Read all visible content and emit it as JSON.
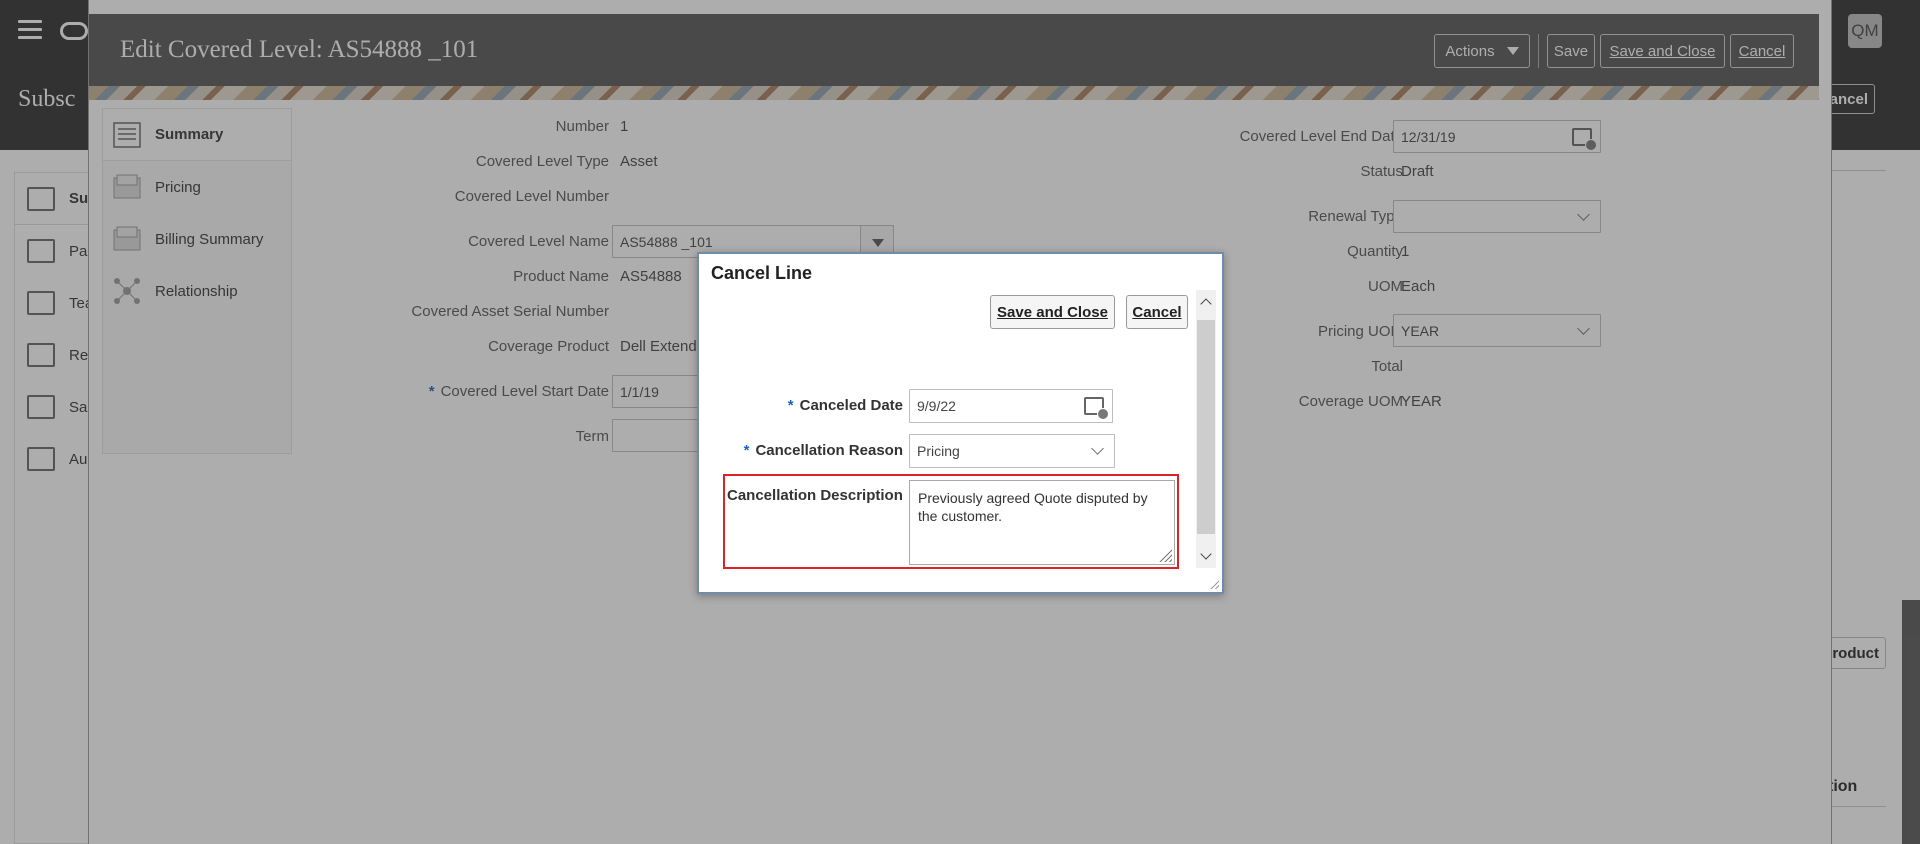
{
  "app": {
    "title_partial": "Subsc",
    "avatar_initials": "QM",
    "bg_cancel_partial": "ancel",
    "bg_product_partial": "roduct",
    "bg_section_partial": "tion",
    "left_nav": [
      {
        "label": "Sur",
        "icon": "list-icon"
      },
      {
        "label": "Par",
        "icon": "contact-card-icon"
      },
      {
        "label": "Tea",
        "icon": "team-icon"
      },
      {
        "label": "Ren",
        "icon": "sliders-icon"
      },
      {
        "label": "Sal",
        "icon": "grid-icon"
      },
      {
        "label": "Aud",
        "icon": "audit-icon"
      }
    ]
  },
  "drawer": {
    "title": "Edit Covered Level: AS54888 _101",
    "actions_label": "Actions",
    "save_label": "Save",
    "save_and_close_label": "Save and Close",
    "cancel_label": "Cancel",
    "side_nav": [
      {
        "label": "Summary",
        "icon": "summary-icon"
      },
      {
        "label": "Pricing",
        "icon": "pricing-icon"
      },
      {
        "label": "Billing Summary",
        "icon": "billing-icon"
      },
      {
        "label": "Relationship",
        "icon": "relationship-icon"
      }
    ],
    "left_fields": {
      "number_label": "Number",
      "number_value": "1",
      "type_label": "Covered Level Type",
      "type_value": "Asset",
      "cl_number_label": "Covered Level Number",
      "name_label": "Covered Level Name",
      "name_value": "AS54888 _101",
      "product_label": "Product Name",
      "product_value": "AS54888",
      "serial_label": "Covered Asset Serial Number",
      "coverage_label": "Coverage Product",
      "coverage_value": "Dell Extend",
      "start_label": "Covered Level Start Date",
      "start_value": "1/1/19",
      "term_label": "Term"
    },
    "right_fields": {
      "end_label": "Covered Level End Date",
      "end_value": "12/31/19",
      "status_label": "Status",
      "status_value": "Draft",
      "renewal_label": "Renewal Type",
      "renewal_value": "",
      "quantity_label": "Quantity",
      "quantity_value": "1",
      "uom_label": "UOM",
      "uom_value": "Each",
      "pricing_uom_label": "Pricing UOM",
      "pricing_uom_value": "YEAR",
      "total_label": "Total",
      "coverage_uom_label": "Coverage UOM",
      "coverage_uom_value": "YEAR"
    }
  },
  "dialog": {
    "title": "Cancel Line",
    "save_close_label": "Save and Close",
    "cancel_label": "Cancel",
    "canceled_date_label": "Canceled Date",
    "canceled_date_value": "9/9/22",
    "reason_label": "Cancellation Reason",
    "reason_value": "Pricing",
    "description_label": "Cancellation Description",
    "description_value": "Previously agreed Quote disputed by the customer.",
    "required_marker": "*"
  }
}
